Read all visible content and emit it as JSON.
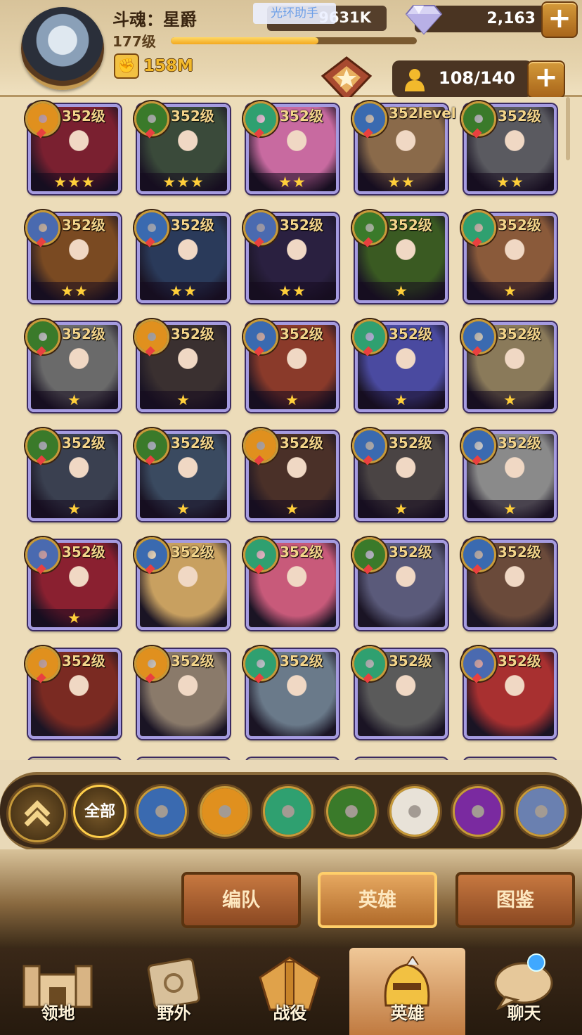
{
  "player": {
    "name": "斗魂：星爵",
    "level": "177级",
    "xp_fraction": 0.6,
    "power": "158M"
  },
  "currency": {
    "gold": "9631K",
    "gems": "2,163"
  },
  "overlay_tag": "光环助手",
  "roster": {
    "count": "108/140"
  },
  "heroes": [
    {
      "level": "352级",
      "faction": "gold",
      "stars": 3,
      "portrait": "#7a2030"
    },
    {
      "level": "352级",
      "faction": "eye",
      "stars": 3,
      "portrait": "#3a4a3a"
    },
    {
      "level": "352级",
      "faction": "leaf",
      "stars": 2,
      "portrait": "#c86aa0"
    },
    {
      "level": "352level",
      "faction": "star",
      "stars": 2,
      "portrait": "#8a6a4a"
    },
    {
      "level": "352级",
      "faction": "eye",
      "stars": 2,
      "portrait": "#5a5a60"
    },
    {
      "level": "352级",
      "faction": "shield",
      "stars": 2,
      "portrait": "#7a4a22"
    },
    {
      "level": "352级",
      "faction": "star",
      "stars": 2,
      "portrait": "#2a3a5a"
    },
    {
      "level": "352级",
      "faction": "shield",
      "stars": 2,
      "portrait": "#2a2040"
    },
    {
      "level": "352级",
      "faction": "eye",
      "stars": 1,
      "portrait": "#3a5a22"
    },
    {
      "level": "352级",
      "faction": "leaf",
      "stars": 1,
      "portrait": "#8a5a3a"
    },
    {
      "level": "352级",
      "faction": "eye",
      "stars": 1,
      "portrait": "#6a6a6a"
    },
    {
      "level": "352级",
      "faction": "gold",
      "stars": 1,
      "portrait": "#3a3030"
    },
    {
      "level": "352级",
      "faction": "star",
      "stars": 1,
      "portrait": "#8a3a2a"
    },
    {
      "level": "352级",
      "faction": "leaf",
      "stars": 1,
      "portrait": "#4a4aa0"
    },
    {
      "level": "352级",
      "faction": "star",
      "stars": 1,
      "portrait": "#8a7a5a"
    },
    {
      "level": "352级",
      "faction": "eye",
      "stars": 1,
      "portrait": "#3a4050"
    },
    {
      "level": "352级",
      "faction": "eye",
      "stars": 1,
      "portrait": "#3a4a60"
    },
    {
      "level": "352级",
      "faction": "gold",
      "stars": 1,
      "portrait": "#4a3028"
    },
    {
      "level": "352级",
      "faction": "star",
      "stars": 1,
      "portrait": "#4a4444"
    },
    {
      "level": "352级",
      "faction": "star",
      "stars": 1,
      "portrait": "#8a8a8a"
    },
    {
      "level": "352级",
      "faction": "shield",
      "stars": 1,
      "portrait": "#8a2030"
    },
    {
      "level": "352级",
      "faction": "star",
      "stars": 0,
      "portrait": "#c8a060"
    },
    {
      "level": "352级",
      "faction": "leaf",
      "stars": 0,
      "portrait": "#c85a7a"
    },
    {
      "level": "352级",
      "faction": "eye",
      "stars": 0,
      "portrait": "#5a5a7a"
    },
    {
      "level": "352级",
      "faction": "star",
      "stars": 0,
      "portrait": "#6a4a3a"
    },
    {
      "level": "352级",
      "faction": "gold",
      "stars": 0,
      "portrait": "#7a2a22"
    },
    {
      "level": "352级",
      "faction": "gold",
      "stars": 0,
      "portrait": "#8a7a6a"
    },
    {
      "level": "352级",
      "faction": "leaf",
      "stars": 0,
      "portrait": "#6a7a8a"
    },
    {
      "level": "352级",
      "faction": "leaf",
      "stars": 0,
      "portrait": "#5a5a5a"
    },
    {
      "level": "352级",
      "faction": "shield",
      "stars": 0,
      "portrait": "#a83030"
    }
  ],
  "filters": {
    "all_label": "全部",
    "factions": [
      "star",
      "gold",
      "leaf",
      "eye",
      "celestial",
      "hypogean",
      "dimensional"
    ]
  },
  "colors": {
    "star": "#3a6ab0",
    "gold": "#e0901e",
    "leaf": "#2fa070",
    "eye": "#3a7a2a",
    "shield": "#4a6ab0",
    "celestial": "#e8e2d8",
    "hypogean": "#7a2aa0",
    "dimensional": "#6a80b0"
  },
  "sub_tabs": {
    "team": "编队",
    "hero": "英雄",
    "collection": "图鉴"
  },
  "nav": {
    "territory": "领地",
    "field": "野外",
    "campaign": "战役",
    "heroes": "英雄",
    "chat": "聊天"
  }
}
